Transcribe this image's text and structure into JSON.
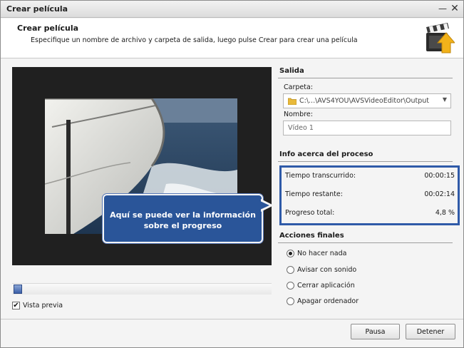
{
  "window": {
    "title": "Crear película"
  },
  "header": {
    "title": "Crear película",
    "description": "Especifique un nombre de archivo y carpeta de salida, luego pulse Crear para crear una película"
  },
  "preview": {
    "label": "Vista previa",
    "checked": true,
    "position_fraction": 0.0
  },
  "output": {
    "section_title": "Salida",
    "folder_label": "Carpeta:",
    "folder_value": "C:\\...\\AVS4YOU\\AVSVideoEditor\\Output",
    "name_label": "Nombre:",
    "name_value": "Vídeo 1"
  },
  "process": {
    "section_title": "Info acerca del proceso",
    "rows": [
      {
        "label": "Tiempo transcurrido:",
        "value": "00:00:15"
      },
      {
        "label": "Tiempo restante:",
        "value": "00:02:14"
      },
      {
        "label": "Progreso total:",
        "value": "4,8 %"
      }
    ]
  },
  "actions": {
    "section_title": "Acciones finales",
    "options": [
      {
        "label": "No hacer nada",
        "selected": true
      },
      {
        "label": "Avisar con sonido",
        "selected": false
      },
      {
        "label": "Cerrar aplicación",
        "selected": false
      },
      {
        "label": "Apagar ordenador",
        "selected": false
      }
    ]
  },
  "tooltip": {
    "text": "Aquí se puede ver la información sobre el progreso"
  },
  "buttons": {
    "pause": "Pausa",
    "stop": "Detener"
  },
  "colors": {
    "accent": "#2f5aa8",
    "tooltip_bg": "#2a5599"
  },
  "icons": {
    "minimize": "minimize-icon",
    "close": "close-icon",
    "clapper": "clapperboard-icon",
    "folder": "folder-icon",
    "dropdown": "chevron-down-icon"
  }
}
